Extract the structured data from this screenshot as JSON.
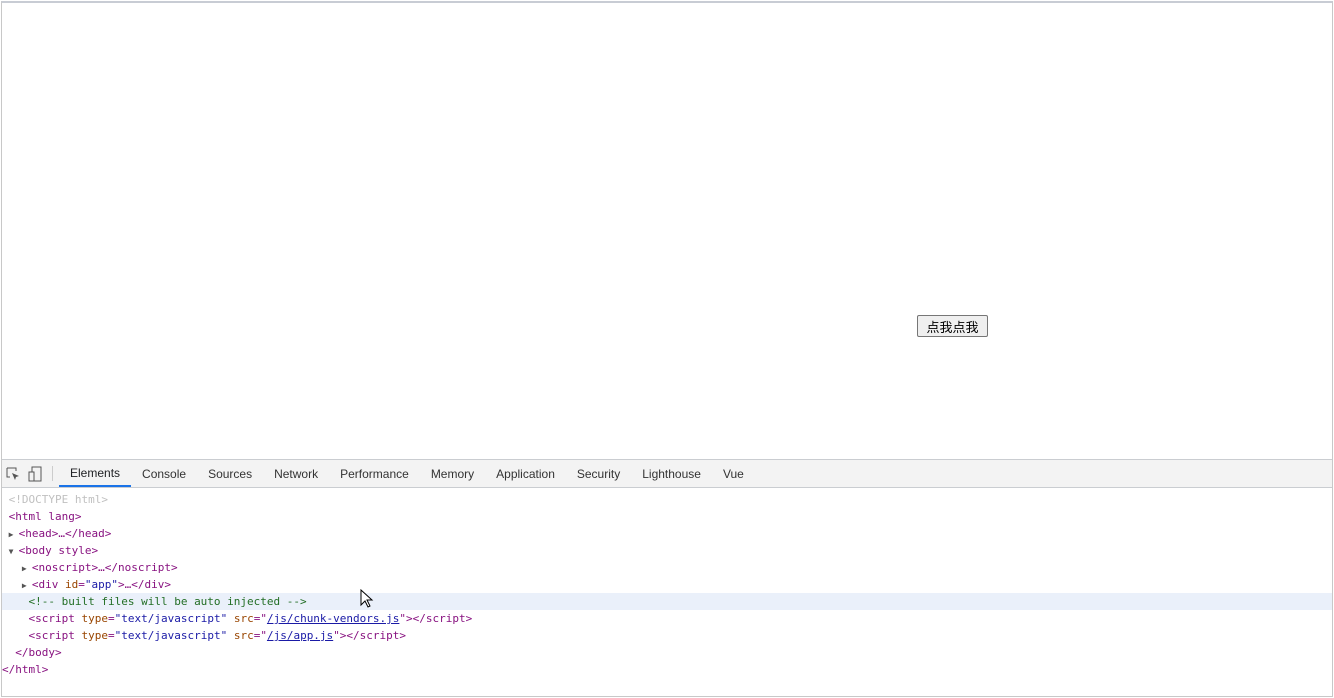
{
  "page": {
    "button_label": "点我点我"
  },
  "devtools": {
    "tabs": [
      "Elements",
      "Console",
      "Sources",
      "Network",
      "Performance",
      "Memory",
      "Application",
      "Security",
      "Lighthouse",
      "Vue"
    ],
    "active_tab": "Elements",
    "tree": {
      "doctype": "<!DOCTYPE html>",
      "html_open": "<html lang>",
      "head": "<head>…</head>",
      "body_open": "<body style>",
      "noscript": "<noscript>…</noscript>",
      "div_tag": "div",
      "div_attr": "id",
      "div_val": "\"app\"",
      "div_rest": ">…</div>",
      "comment": "<!-- built files will be auto injected -->",
      "script_type": "\"text/javascript\"",
      "script1_src": "/js/chunk-vendors.js",
      "script2_src": "/js/app.js",
      "body_close": "</body>",
      "html_close": "</html>"
    }
  }
}
